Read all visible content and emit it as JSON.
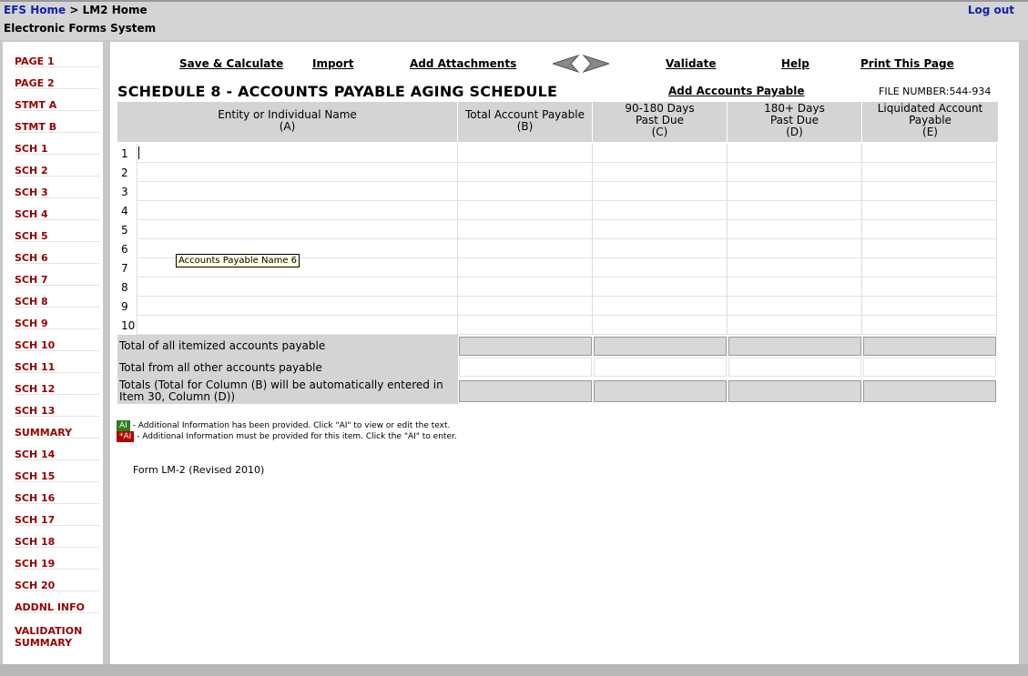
{
  "header": {
    "efs_home": "EFS Home",
    "separator": " > ",
    "lm2_home": "LM2 Home",
    "logout": "Log out",
    "system_name": "Electronic Forms System"
  },
  "sidebar": {
    "items": [
      "PAGE 1",
      "PAGE 2",
      "STMT A",
      "STMT B",
      "SCH 1",
      "SCH 2",
      "SCH 3",
      "SCH 4",
      "SCH 5",
      "SCH 6",
      "SCH 7",
      "SCH 8",
      "SCH 9",
      "SCH 10",
      "SCH 11",
      "SCH 12",
      "SCH 13",
      "SUMMARY",
      "SCH 14",
      "SCH 15",
      "SCH 16",
      "SCH 17",
      "SCH 18",
      "SCH 19",
      "SCH 20",
      "ADDNL INFO"
    ],
    "validation_summary": [
      "VALIDATION",
      "SUMMARY"
    ]
  },
  "toolbar": {
    "save_calculate": "Save & Calculate",
    "import": "Import",
    "add_attachments": "Add Attachments",
    "validate": "Validate",
    "help": "Help",
    "print_page": "Print This Page",
    "prev_icon": "arrow-left-icon",
    "next_icon": "arrow-right-icon"
  },
  "page": {
    "title": "SCHEDULE 8 - ACCOUNTS PAYABLE AGING SCHEDULE",
    "add_accounts_payable": "Add Accounts Payable",
    "file_number_label": "FILE NUMBER:",
    "file_number": "544-934"
  },
  "table": {
    "columns": [
      {
        "line1": "Entity or Individual Name",
        "line2": "(A)",
        "line3": ""
      },
      {
        "line1": "Total Account Payable",
        "line2": "(B)",
        "line3": ""
      },
      {
        "line1": "90-180 Days",
        "line2": "Past Due",
        "line3": "(C)"
      },
      {
        "line1": "180+ Days",
        "line2": "Past Due",
        "line3": "(D)"
      },
      {
        "line1": "Liquidated Account",
        "line2": "Payable",
        "line3": "(E)"
      }
    ],
    "row_numbers": [
      "1",
      "2",
      "3",
      "4",
      "5",
      "6",
      "7",
      "8",
      "9",
      "10"
    ],
    "tooltip": "Accounts Payable Name 6",
    "totals": [
      "Total of all itemized accounts payable",
      "Total from all other accounts payable",
      "Totals (Total for Column (B) will be automatically entered in Item 30, Column (D))"
    ]
  },
  "legend": {
    "ai_badge": "AI",
    "ai_text": " - Additional Information has been provided. Click \"AI\" to view or edit the text.",
    "ai_required_badge": "*AI",
    "ai_required_text": " - Additional Information must be provided for this item. Click the \"AI\" to enter."
  },
  "colors": {
    "nav_red": "#990000",
    "link_blue": "#1020b0",
    "ai_green": "#2e7d1f",
    "ai_red": "#b00000"
  },
  "footer": {
    "form_label": "Form LM-2 (Revised 2010)"
  }
}
